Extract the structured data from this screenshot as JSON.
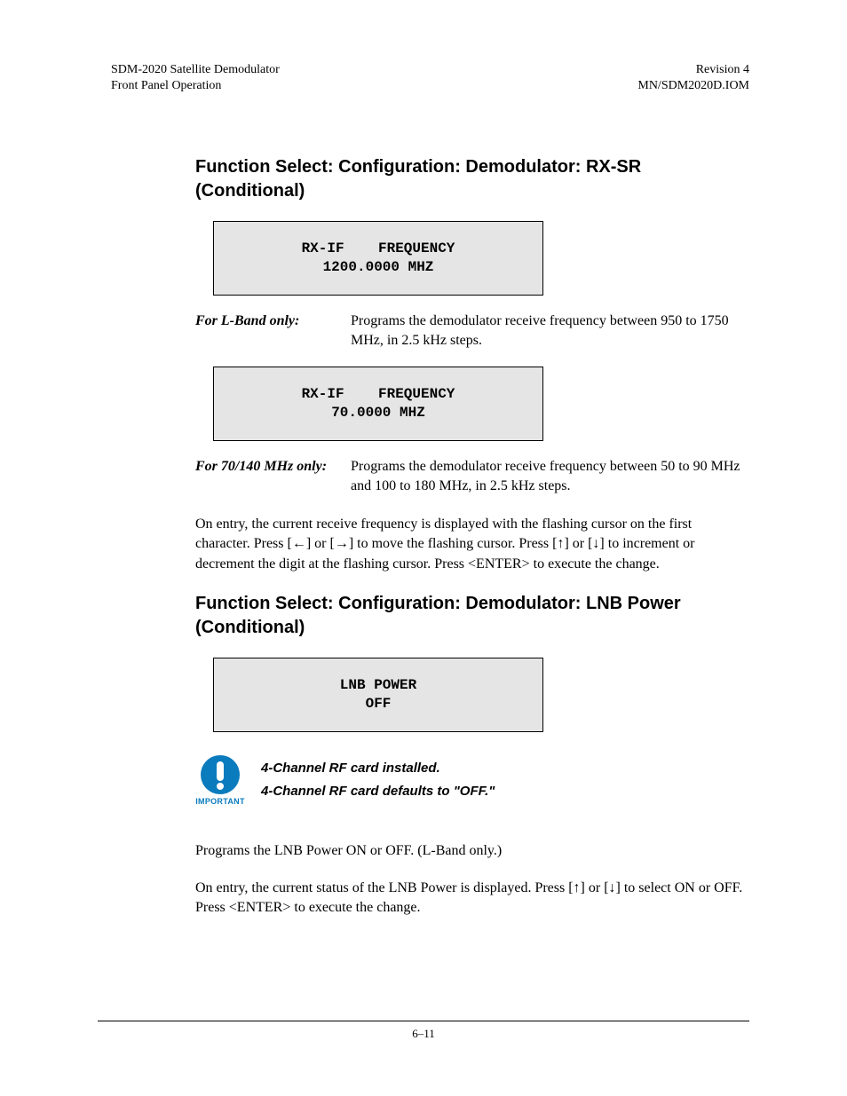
{
  "header": {
    "left_line1": "SDM-2020 Satellite Demodulator",
    "left_line2": "Front Panel Operation",
    "right_line1": "Revision 4",
    "right_line2": "MN/SDM2020D.IOM"
  },
  "section1": {
    "heading": "Function Select: Configuration: Demodulator: RX-SR (Conditional)",
    "lcd1": {
      "line1": "RX-IF    FREQUENCY",
      "line2": "1200.0000 MHZ"
    },
    "def1": {
      "term": "For L-Band only:",
      "body": "Programs the demodulator receive frequency between 950 to 1750 MHz, in 2.5 kHz steps."
    },
    "lcd2": {
      "line1": "RX-IF    FREQUENCY",
      "line2": "70.0000 MHZ"
    },
    "def2": {
      "term": "For 70/140 MHz only:",
      "body": "Programs the demodulator receive frequency between 50 to 90 MHz and 100 to 180 MHz, in 2.5 kHz steps."
    },
    "para": "On entry, the current receive frequency is displayed with the flashing cursor on the first character. Press [←] or [→] to move the flashing cursor. Press [↑] or [↓] to increment or decrement the digit at the flashing cursor. Press <ENTER> to execute the change."
  },
  "section2": {
    "heading": "Function Select: Configuration: Demodulator: LNB Power (Conditional)",
    "lcd": {
      "line1": "LNB POWER",
      "line2": "OFF"
    },
    "important": {
      "label": "IMPORTANT",
      "line1": "4-Channel RF card installed.",
      "line2": "4-Channel RF card defaults to \"OFF.\""
    },
    "para1": "Programs the LNB Power ON or OFF. (L-Band only.)",
    "para2": "On entry, the current status of the LNB Power is displayed. Press [↑] or [↓] to select ON or OFF. Press <ENTER> to execute the change."
  },
  "footer": {
    "page": "6–11"
  }
}
